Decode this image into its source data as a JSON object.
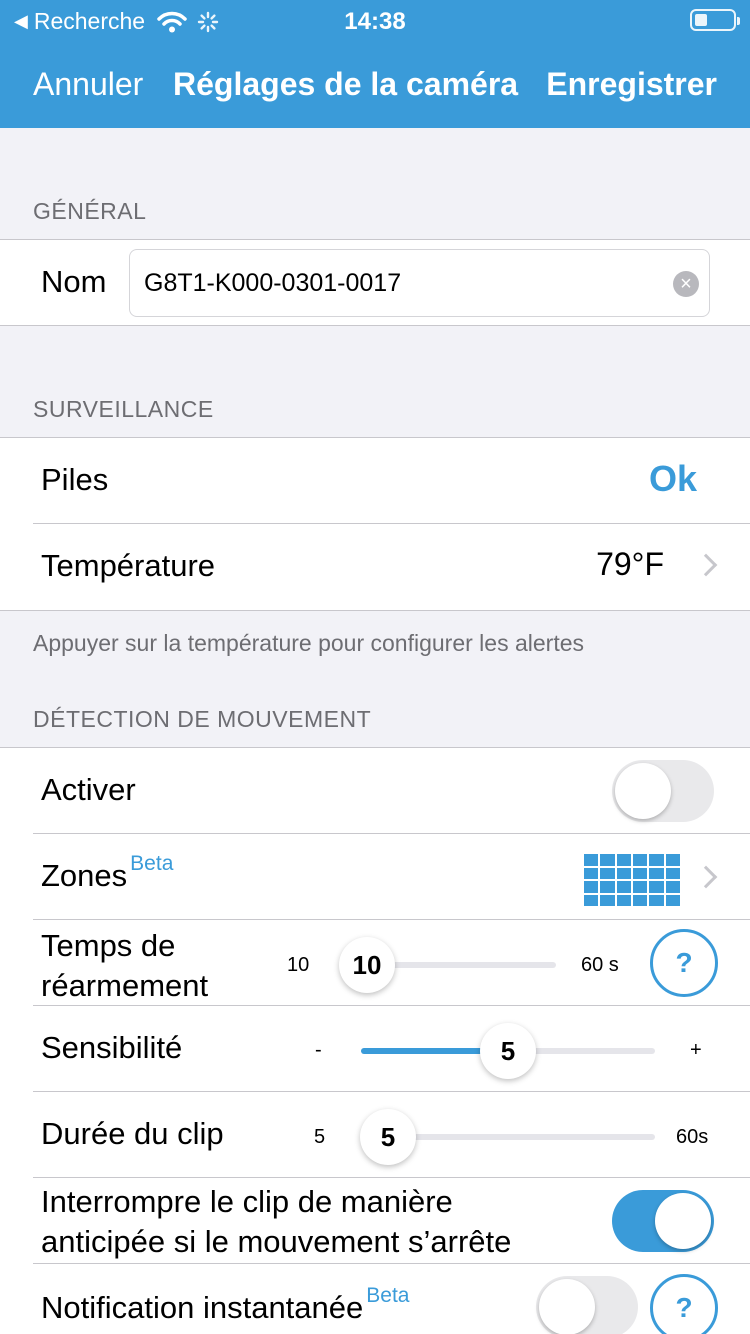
{
  "status_bar": {
    "back_app": "Recherche",
    "time": "14:38"
  },
  "nav": {
    "cancel": "Annuler",
    "title": "Réglages de la caméra",
    "save": "Enregistrer"
  },
  "general": {
    "header": "GÉNÉRAL",
    "name_label": "Nom",
    "name_value": "G8T1-K000-0301-0017"
  },
  "surveillance": {
    "header": "SURVEILLANCE",
    "battery_label": "Piles",
    "battery_value": "Ok",
    "temperature_label": "Température",
    "temperature_value": "79°F",
    "note": "Appuyer sur la température pour configurer les alertes"
  },
  "motion": {
    "header": "DÉTECTION DE MOUVEMENT",
    "enable_label": "Activer",
    "enable_on": false,
    "zones_label": "Zones",
    "zones_badge": "Beta",
    "rearm": {
      "label_line1": "Temps de",
      "label_line2": "réarmement",
      "min_label": "10",
      "max_label": "60 s",
      "value": "10",
      "fraction": 0.0,
      "help": "?"
    },
    "sensitivity": {
      "label": "Sensibilité",
      "min_label": "-",
      "max_label": "+",
      "value": "5",
      "fraction": 0.5
    },
    "clip": {
      "label": "Durée du clip",
      "min_label": "5",
      "max_label": "60s",
      "value": "5",
      "fraction": 0.0
    },
    "stop_early": {
      "label_line1": "Interrompre le clip de manière",
      "label_line2": "anticipée si le mouvement s’arrête",
      "on": true
    },
    "instant_notif": {
      "label": "Notification instantanée",
      "badge": "Beta",
      "on": false,
      "help": "?"
    }
  },
  "colors": {
    "accent": "#3a9bd9",
    "background": "#f2f2f7",
    "separator": "#c8c7cc"
  }
}
